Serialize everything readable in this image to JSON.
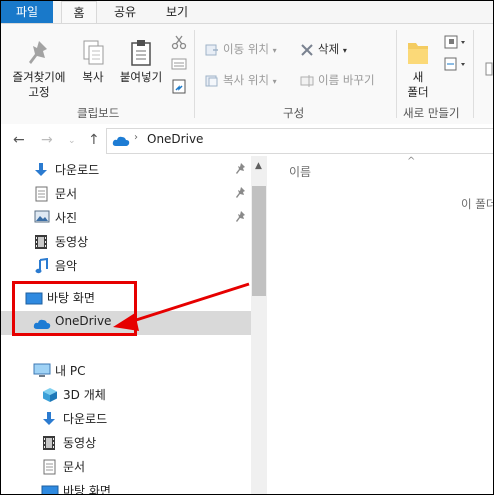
{
  "ribbon_tabs": [
    "파일",
    "홈",
    "공유",
    "보기"
  ],
  "clipboard": {
    "pin_label": "즐겨찾기에\n고정",
    "copy_label": "복사",
    "paste_label": "붙여넣기",
    "group_label": "클립보드"
  },
  "organize": {
    "move_label": "이동 위치",
    "copyto_label": "복사 위치",
    "delete_label": "삭제",
    "rename_label": "이름 바꾸기",
    "group_label": "구성"
  },
  "new_group": {
    "newfolder_label": "새\n폴더",
    "group_label": "새로 만들기"
  },
  "address": {
    "path": "OneDrive"
  },
  "nav_pane": {
    "quick": [
      {
        "label": "다운로드",
        "icon": "download-icon",
        "pinned": true
      },
      {
        "label": "문서",
        "icon": "document-icon",
        "pinned": true
      },
      {
        "label": "사진",
        "icon": "pictures-icon",
        "pinned": true
      },
      {
        "label": "동영상",
        "icon": "video-icon",
        "pinned": false
      },
      {
        "label": "음악",
        "icon": "music-icon",
        "pinned": false
      }
    ],
    "desktop": "바탕 화면",
    "onedrive": "OneDrive",
    "this_pc": "내 PC",
    "pc_items": [
      {
        "label": "3D 개체",
        "icon": "3d-objects-icon"
      },
      {
        "label": "다운로드",
        "icon": "download-icon"
      },
      {
        "label": "동영상",
        "icon": "video-icon"
      },
      {
        "label": "문서",
        "icon": "document-icon"
      },
      {
        "label": "바탕 화면",
        "icon": "desktop-icon"
      }
    ]
  },
  "content": {
    "column_name": "이름",
    "empty_text": "이 폴더"
  },
  "colors": {
    "accent": "#1979ca",
    "highlight": "#e60000",
    "selection": "#d9d9d9"
  }
}
